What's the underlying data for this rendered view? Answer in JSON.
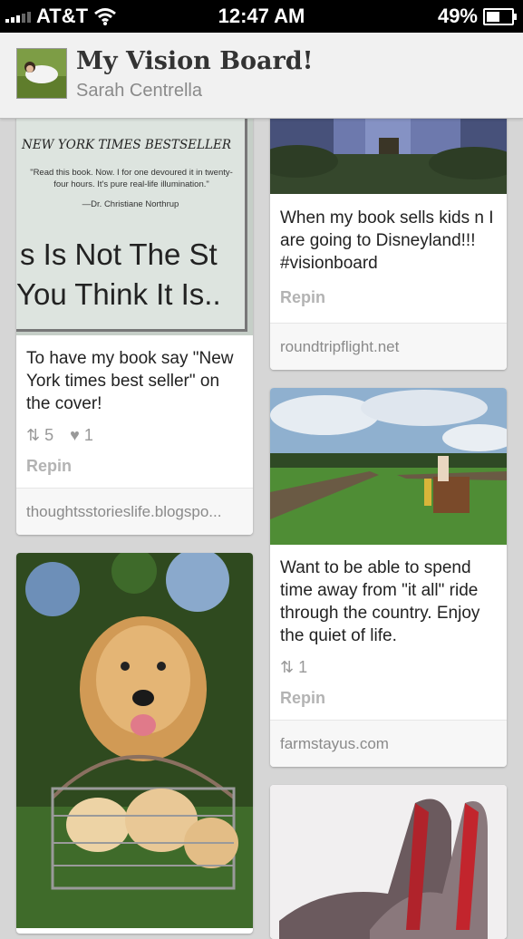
{
  "status_bar": {
    "carrier": "AT&T",
    "time": "12:47 AM",
    "battery": "49%"
  },
  "header": {
    "title": "My Vision Board!",
    "owner": "Sarah Centrella"
  },
  "pins": [
    {
      "book_line1": "NEW YORK TIMES BESTSELLER",
      "book_quote": "\"Read this book. Now. I for one devoured it in twenty-four hours. It's pure real-life illumination.\"",
      "book_attribution": "—Dr. Christiane Northrup",
      "book_title1": "s Is Not The St",
      "book_title2": "You Think It Is..",
      "description": "To have my book say \"New York times best seller\" on the cover!",
      "repins": "5",
      "likes": "1",
      "repin_label": "Repin",
      "source": "thoughtsstorieslife.blogspo..."
    },
    {
      "description": "When my book sells kids n I are going to Disneyland!!! #visionboard",
      "repin_label": "Repin",
      "source": "roundtripflight.net"
    },
    {
      "description": "Want to be able to spend time away from \"it all\" ride through the country. Enjoy the quiet of life.",
      "repins": "1",
      "repin_label": "Repin",
      "source": "farmstayus.com"
    }
  ]
}
